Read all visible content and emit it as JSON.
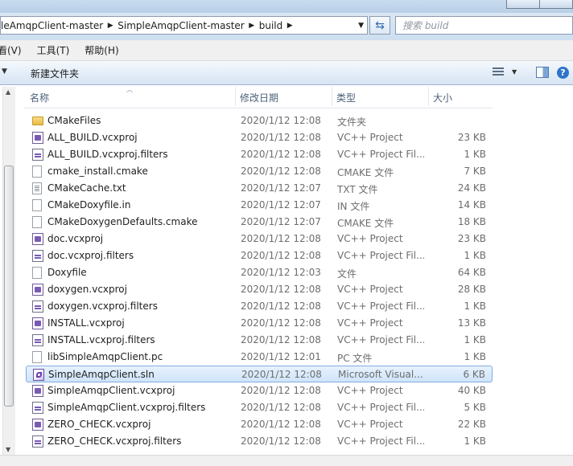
{
  "address": {
    "crumbs": [
      "leAmqpClient-master",
      "SimpleAmqpClient-master",
      "build"
    ]
  },
  "search": {
    "placeholder": "搜索 build"
  },
  "menu": [
    "看(V)",
    "工具(T)",
    "帮助(H)"
  ],
  "toolbar": {
    "new_folder": "新建文件夹"
  },
  "columns": {
    "name": "名称",
    "date": "修改日期",
    "type": "类型",
    "size": "大小"
  },
  "files": [
    {
      "name": "CMakeFiles",
      "date": "2020/1/12 12:08",
      "type": "文件夹",
      "size": "",
      "icon": "folder"
    },
    {
      "name": "ALL_BUILD.vcxproj",
      "date": "2020/1/12 12:08",
      "type": "VC++ Project",
      "size": "23 KB",
      "icon": "vcxproj"
    },
    {
      "name": "ALL_BUILD.vcxproj.filters",
      "date": "2020/1/12 12:08",
      "type": "VC++ Project Fil...",
      "size": "1 KB",
      "icon": "filters"
    },
    {
      "name": "cmake_install.cmake",
      "date": "2020/1/12 12:08",
      "type": "CMAKE 文件",
      "size": "7 KB",
      "icon": "doc"
    },
    {
      "name": "CMakeCache.txt",
      "date": "2020/1/12 12:07",
      "type": "TXT 文件",
      "size": "24 KB",
      "icon": "txt"
    },
    {
      "name": "CMakeDoxyfile.in",
      "date": "2020/1/12 12:07",
      "type": "IN 文件",
      "size": "14 KB",
      "icon": "doc"
    },
    {
      "name": "CMakeDoxygenDefaults.cmake",
      "date": "2020/1/12 12:07",
      "type": "CMAKE 文件",
      "size": "18 KB",
      "icon": "doc"
    },
    {
      "name": "doc.vcxproj",
      "date": "2020/1/12 12:08",
      "type": "VC++ Project",
      "size": "23 KB",
      "icon": "vcxproj"
    },
    {
      "name": "doc.vcxproj.filters",
      "date": "2020/1/12 12:08",
      "type": "VC++ Project Fil...",
      "size": "1 KB",
      "icon": "filters"
    },
    {
      "name": "Doxyfile",
      "date": "2020/1/12 12:03",
      "type": "文件",
      "size": "64 KB",
      "icon": "doc"
    },
    {
      "name": "doxygen.vcxproj",
      "date": "2020/1/12 12:08",
      "type": "VC++ Project",
      "size": "28 KB",
      "icon": "vcxproj"
    },
    {
      "name": "doxygen.vcxproj.filters",
      "date": "2020/1/12 12:08",
      "type": "VC++ Project Fil...",
      "size": "1 KB",
      "icon": "filters"
    },
    {
      "name": "INSTALL.vcxproj",
      "date": "2020/1/12 12:08",
      "type": "VC++ Project",
      "size": "13 KB",
      "icon": "vcxproj"
    },
    {
      "name": "INSTALL.vcxproj.filters",
      "date": "2020/1/12 12:08",
      "type": "VC++ Project Fil...",
      "size": "1 KB",
      "icon": "filters"
    },
    {
      "name": "libSimpleAmqpClient.pc",
      "date": "2020/1/12 12:01",
      "type": "PC 文件",
      "size": "1 KB",
      "icon": "doc"
    },
    {
      "name": "SimpleAmqpClient.sln",
      "date": "2020/1/12 12:08",
      "type": "Microsoft Visual...",
      "size": "6 KB",
      "icon": "sln",
      "selected": true
    },
    {
      "name": "SimpleAmqpClient.vcxproj",
      "date": "2020/1/12 12:08",
      "type": "VC++ Project",
      "size": "40 KB",
      "icon": "vcxproj"
    },
    {
      "name": "SimpleAmqpClient.vcxproj.filters",
      "date": "2020/1/12 12:08",
      "type": "VC++ Project Fil...",
      "size": "5 KB",
      "icon": "filters"
    },
    {
      "name": "ZERO_CHECK.vcxproj",
      "date": "2020/1/12 12:08",
      "type": "VC++ Project",
      "size": "22 KB",
      "icon": "vcxproj"
    },
    {
      "name": "ZERO_CHECK.vcxproj.filters",
      "date": "2020/1/12 12:08",
      "type": "VC++ Project Fil...",
      "size": "1 KB",
      "icon": "filters"
    }
  ]
}
